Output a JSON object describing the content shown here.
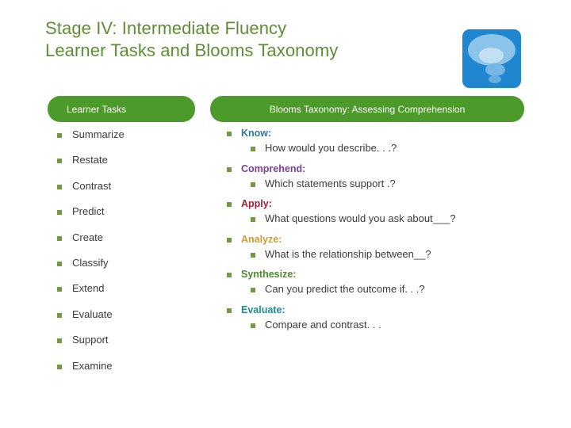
{
  "slide": {
    "title_lines": [
      "Stage IV: Intermediate Fluency",
      "Learner Tasks and Blooms Taxonomy"
    ],
    "title_color": "#5E8D36",
    "logo": {
      "icon": "thought-bubble-icon",
      "background_color": "#2186D0"
    },
    "headers": {
      "left": "Learner Tasks",
      "right": "Blooms Taxonomy: Assessing Comprehension",
      "bar_color": "#4B9A2A"
    },
    "learner_tasks": [
      {
        "label": "Summarize"
      },
      {
        "label": "Restate"
      },
      {
        "label": "Contrast"
      },
      {
        "label": "Predict"
      },
      {
        "label": "Create"
      },
      {
        "label": "Classify"
      },
      {
        "label": "Extend"
      },
      {
        "label": "Evaluate"
      },
      {
        "label": "Support"
      },
      {
        "label": "Examine"
      }
    ],
    "blooms": [
      {
        "heading": "Know:",
        "heading_color": "#2E7B9B",
        "prompt": "How would you describe. . .?"
      },
      {
        "heading": "Comprehend:",
        "heading_color": "#7B3F98",
        "prompt": "Which statements support .?"
      },
      {
        "heading": "Apply:",
        "heading_color": "#9B2335",
        "prompt": "What questions would you ask about___?"
      },
      {
        "heading": "Analyze:",
        "heading_color": "#D99B20",
        "prompt": "What is the relationship between__?"
      },
      {
        "heading": "Synthesize:",
        "heading_color": "#4B8B2B",
        "prompt": "Can you predict the outcome if. . .?"
      },
      {
        "heading": "Evaluate:",
        "heading_color": "#218B8B",
        "prompt": "Compare and contrast. . ."
      }
    ],
    "bullet_color": "#6E9C3E"
  }
}
